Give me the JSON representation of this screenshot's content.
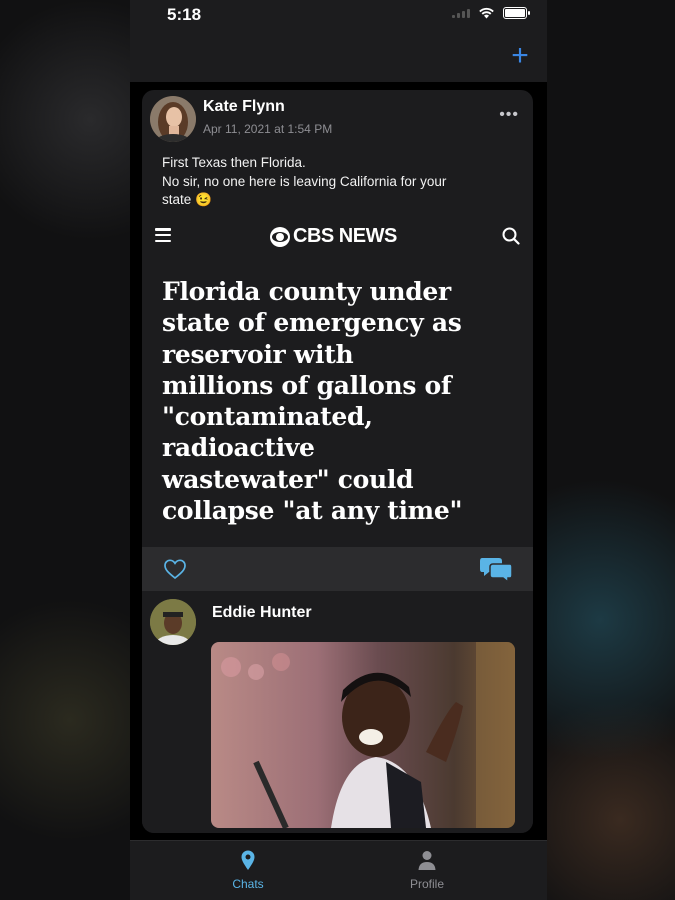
{
  "status_bar": {
    "time": "5:18"
  },
  "nav": {
    "add_icon": "plus-icon"
  },
  "post": {
    "author": "Kate Flynn",
    "date": "Apr 11, 2021 at 1:54 PM",
    "text_lines": [
      "First Texas then Florida.",
      "No sir, no one here is leaving California for your",
      "state 😉"
    ],
    "article": {
      "source": "CBS NEWS",
      "headline_lines": [
        "Florida county under",
        "state of emergency as",
        "reservoir with",
        "millions of gallons of",
        "\"contaminated,",
        "radioactive",
        "wastewater\" could",
        "collapse \"at any time\""
      ]
    }
  },
  "comment": {
    "author": "Eddie Hunter"
  },
  "tabs": [
    {
      "label": "Chats",
      "icon": "location-pin-icon",
      "active": true
    },
    {
      "label": "Profile",
      "icon": "person-icon",
      "active": false
    }
  ],
  "colors": {
    "accent": "#3a86e4",
    "tab_active": "#5ab4e6",
    "background": "#1c1c1e"
  }
}
